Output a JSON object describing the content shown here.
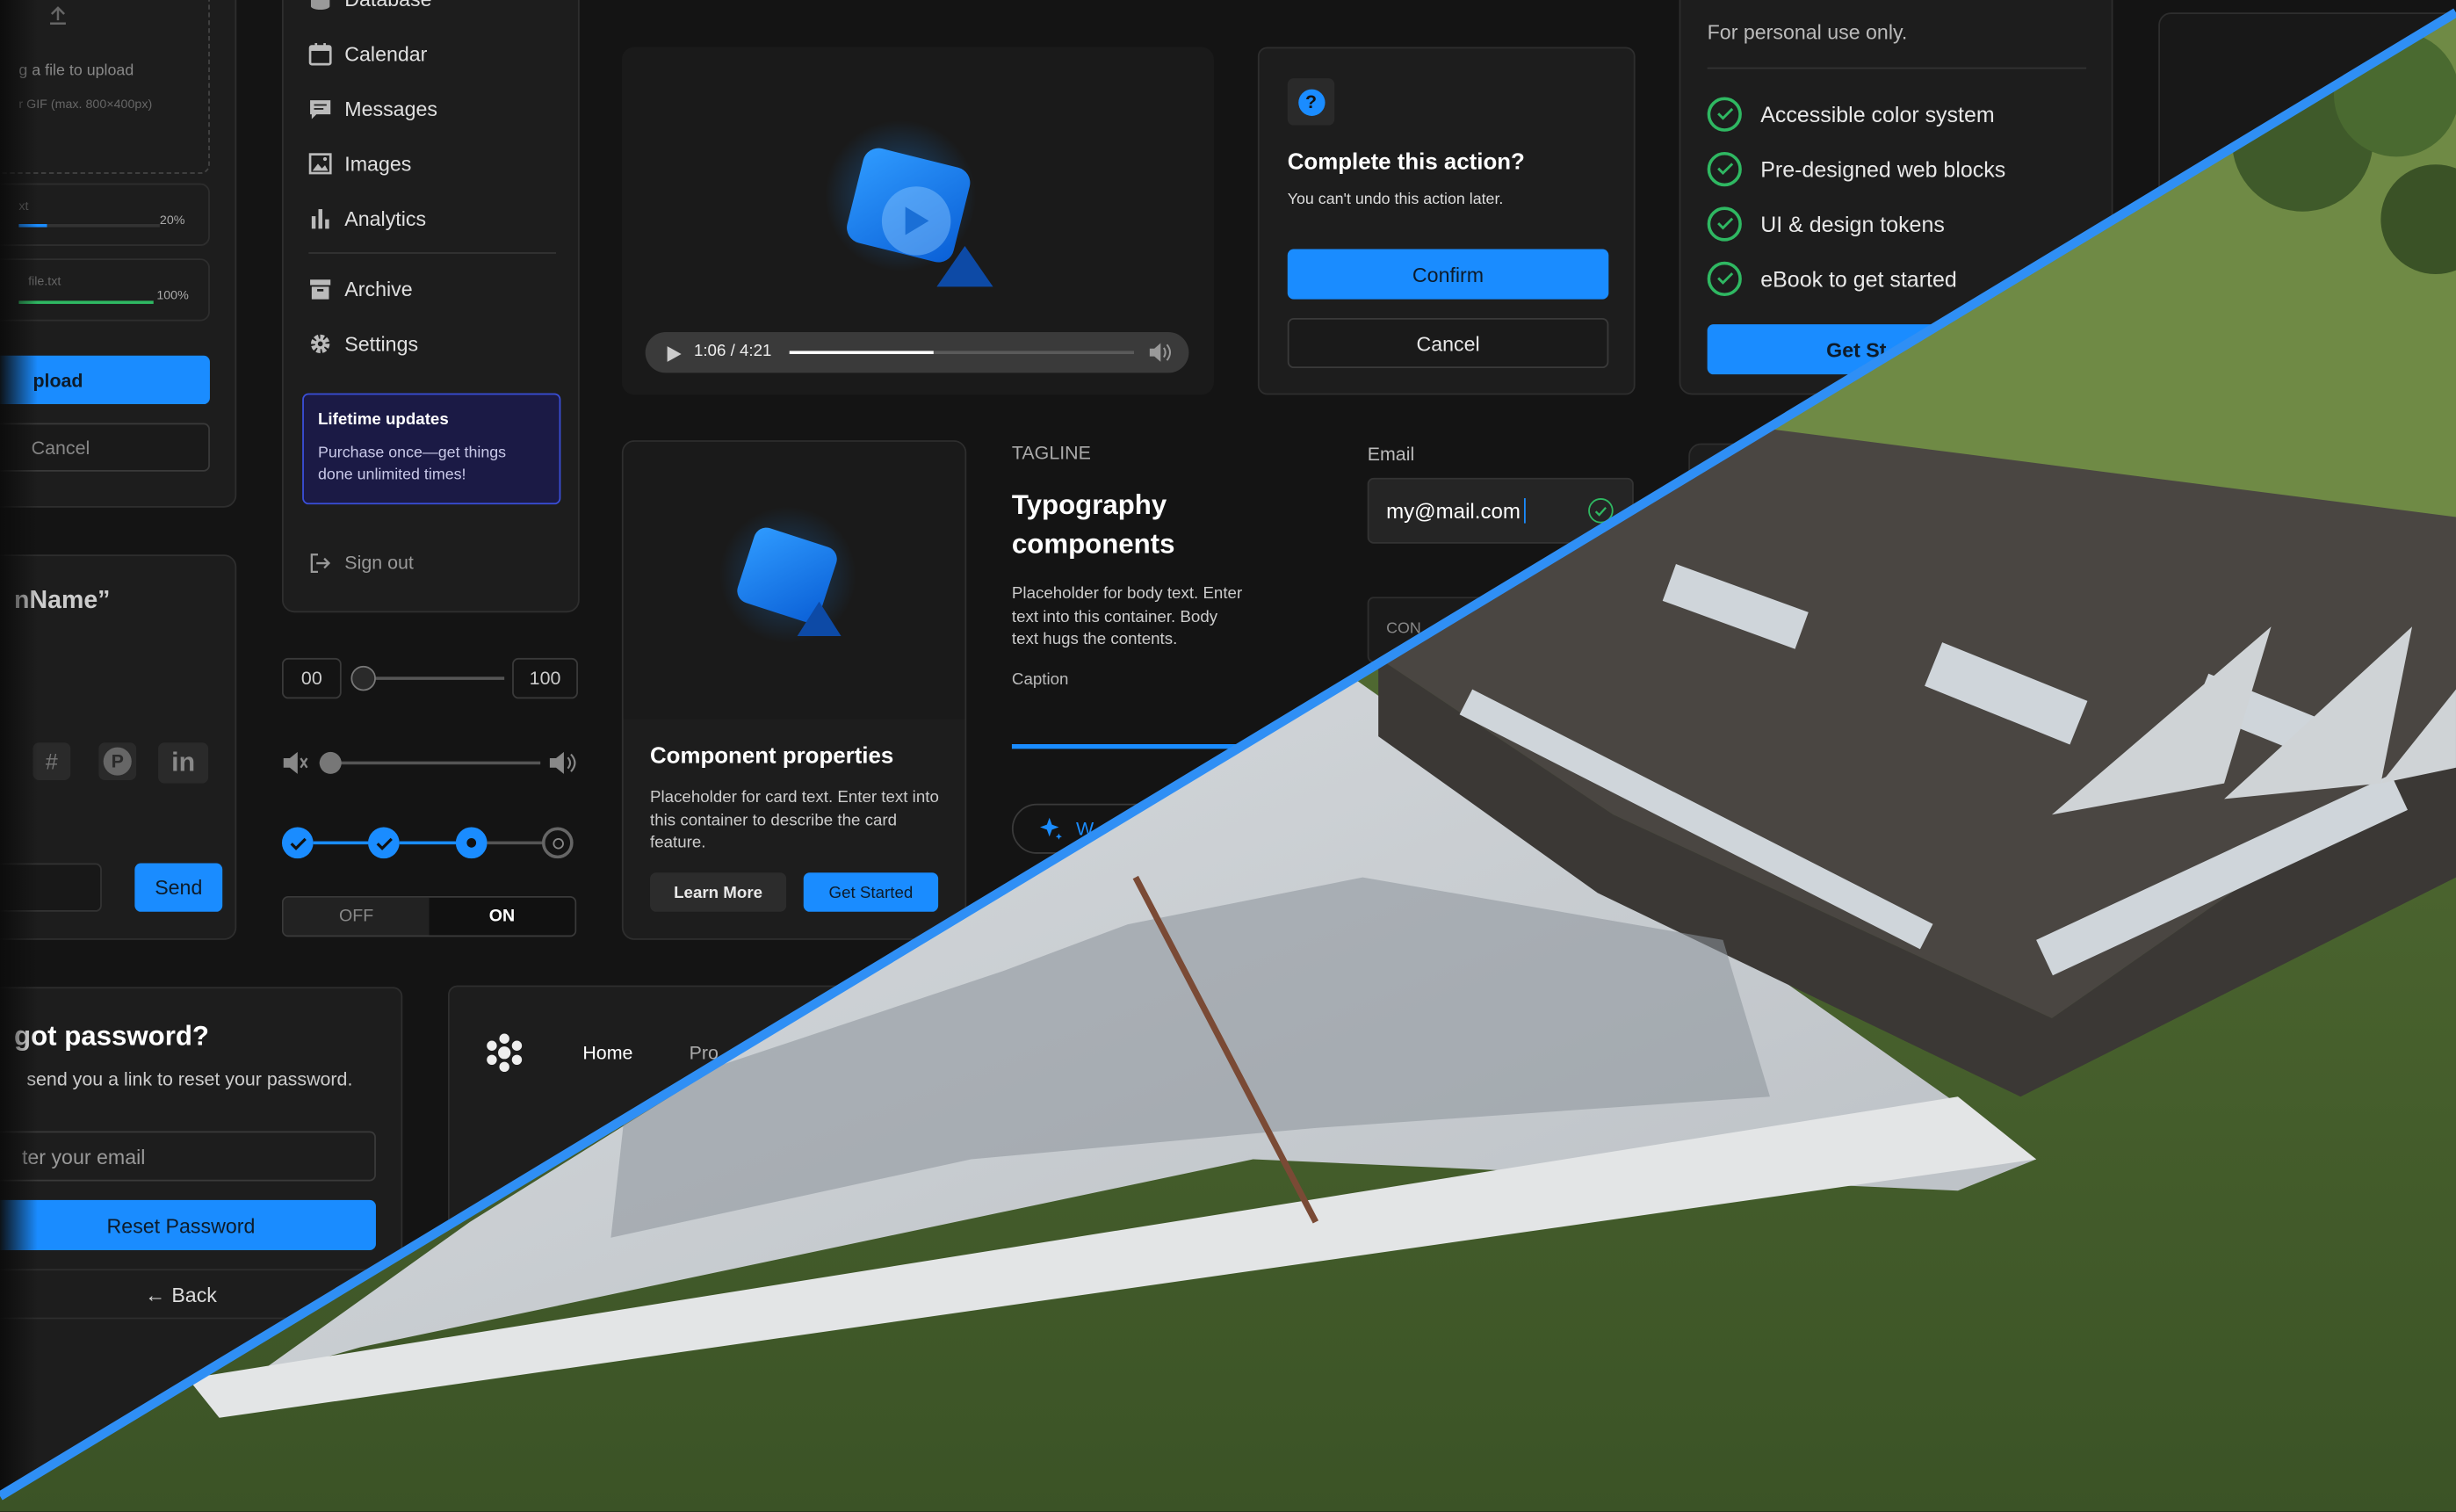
{
  "upload_card": {
    "drag_text": "g a file to upload",
    "format_hint": "r GIF (max. 800×400px)",
    "file1_name": "xt",
    "file1_progress": 20,
    "file1_percent": "20%",
    "file2_name": "file.txt",
    "file2_progress": 100,
    "file2_percent": "100%",
    "upload_label": "pload",
    "cancel_label": "Cancel"
  },
  "sidebar": {
    "items": [
      {
        "label": "Database",
        "icon": "database-icon"
      },
      {
        "label": "Calendar",
        "icon": "calendar-icon"
      },
      {
        "label": "Messages",
        "icon": "messages-icon"
      },
      {
        "label": "Images",
        "icon": "images-icon"
      },
      {
        "label": "Analytics",
        "icon": "analytics-icon"
      },
      {
        "label": "Archive",
        "icon": "archive-icon"
      },
      {
        "label": "Settings",
        "icon": "gear-icon"
      }
    ],
    "promo_title": "Lifetime updates",
    "promo_text": "Purchase once—get things done unlimited times!",
    "sign_out": "Sign out"
  },
  "video": {
    "time": "1:06 / 4:21",
    "progress": 0.42
  },
  "dialog": {
    "title": "Complete this action?",
    "subtitle": "You can't undo this action later.",
    "confirm": "Confirm",
    "cancel": "Cancel"
  },
  "pricing": {
    "note": "For personal use only.",
    "features": [
      "Accessible color system",
      "Pre-designed web blocks",
      "UI & design tokens",
      "eBook to get started"
    ],
    "cta": "Get St"
  },
  "product_card": {
    "title": "Component properties",
    "body": "Placeholder for card text. Enter text into this container to describe the card feature.",
    "learn_more": "Learn More",
    "get_started": "Get Started"
  },
  "typography": {
    "tagline": "TAGLINE",
    "title": "Typography components",
    "body": "Placeholder for body text. Enter text into this container. Body text hugs the contents.",
    "caption": "Caption",
    "chip_label": "W"
  },
  "email": {
    "label": "Email",
    "value": "my@mail.com",
    "below_label": "CON"
  },
  "name_card": {
    "heading": "nName”",
    "send": "Send",
    "social": [
      "slack-icon",
      "pinterest-icon",
      "linkedin-icon"
    ],
    "linkedin_text": "in"
  },
  "controls": {
    "range_min": "00",
    "range_max": "100",
    "range_value": 0,
    "volume_value": 0,
    "stepper_steps": 4,
    "stepper_current": 3,
    "toggle_off": "OFF",
    "toggle_on": "ON"
  },
  "forgot": {
    "title": "got password?",
    "subtitle": "send you a link to reset your password.",
    "placeholder": "ter your email",
    "reset": "Reset Password",
    "back": "Back"
  },
  "navbar": {
    "home": "Home",
    "products": "Pro"
  },
  "colors": {
    "accent": "#1a8cff",
    "success": "#2fb862",
    "divider": "#2f8ff5"
  }
}
